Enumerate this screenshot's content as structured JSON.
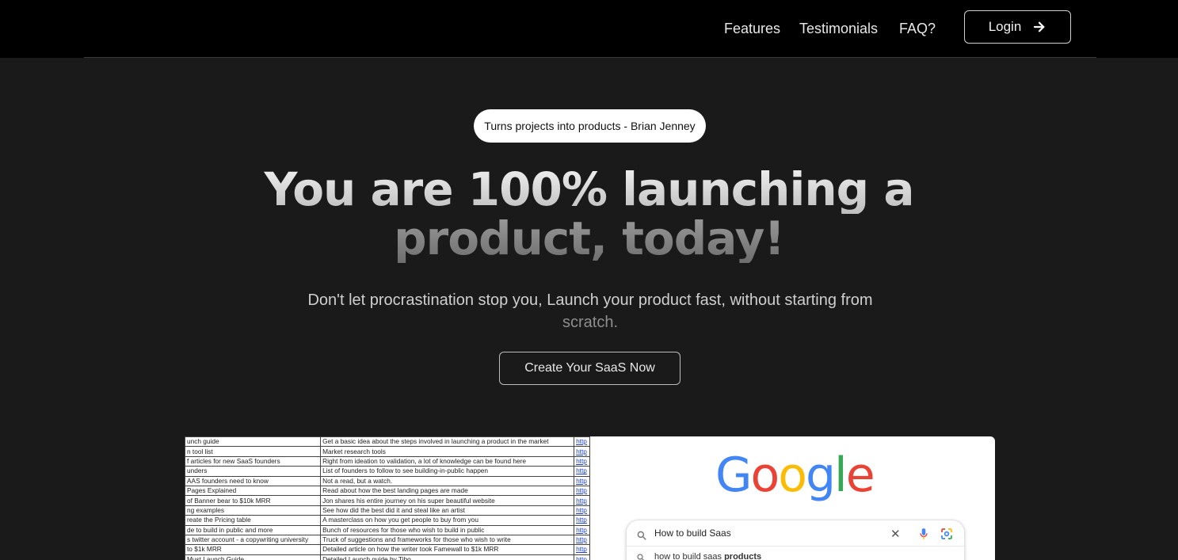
{
  "nav": {
    "features": "Features",
    "testimonials": "Testimonials",
    "faq": "FAQ?",
    "login": "Login"
  },
  "hero": {
    "pill": "Turns projects into products - Brian Jenney",
    "headline_line1": "You are 100% launching a",
    "headline_line2": "product, today!",
    "subtitle_main": "Don't let procrastination stop you, Launch your product fast, without starting from",
    "subtitle_end": "scratch.",
    "cta": "Create Your SaaS Now"
  },
  "preview": {
    "sheet_rows": [
      {
        "name": "unch guide",
        "desc": "Get a basic idea about the steps involved in launching a product in the market",
        "link": "http"
      },
      {
        "name": "n tool list",
        "desc": "Market research tools",
        "link": "http"
      },
      {
        "name": "f articles for new SaaS founders",
        "desc": "Right from ideation to validation, a lot of knowledge can be found here",
        "link": "http"
      },
      {
        "name": "unders",
        "desc": "List of founders to follow to see building-in-public happen",
        "link": "http"
      },
      {
        "name": "AAS founders need to know",
        "desc": "Not a read, but a watch.",
        "link": "http"
      },
      {
        "name": " Pages Explained",
        "desc": "Read about how the best landing pages are made",
        "link": "http"
      },
      {
        "name": "of Banner bear to $10k MRR",
        "desc": "Jon shares his entire journey on his super beautiful website",
        "link": "http"
      },
      {
        "name": "ng examples",
        "desc": "See how did the best did it and steal like an artist",
        "link": "http"
      },
      {
        "name": "reate the Pricing table",
        "desc": "A masterclass on how you get people to buy from you",
        "link": "http"
      },
      {
        "name": "de to build in public and more",
        "desc": "Bunch of resources for those who wish to build in public",
        "link": "http"
      },
      {
        "name": "s twitter account - a copywriting university",
        "desc": "Truck of suggestions and frameworks for those who wish to write",
        "link": "http"
      },
      {
        "name": "to $1k MRR",
        "desc": "Detailed article on how the writer took Famewall to $1k MRR",
        "link": "http"
      },
      {
        "name": "Must Launch Guide",
        "desc": "Detailed Launch guide by Tibo",
        "link": "http"
      }
    ],
    "google": {
      "logo_letters": [
        "G",
        "o",
        "o",
        "g",
        "l",
        "e"
      ],
      "query": "How to build Saas",
      "suggestion_plain": "how to build saas ",
      "suggestion_bold": "products"
    }
  }
}
